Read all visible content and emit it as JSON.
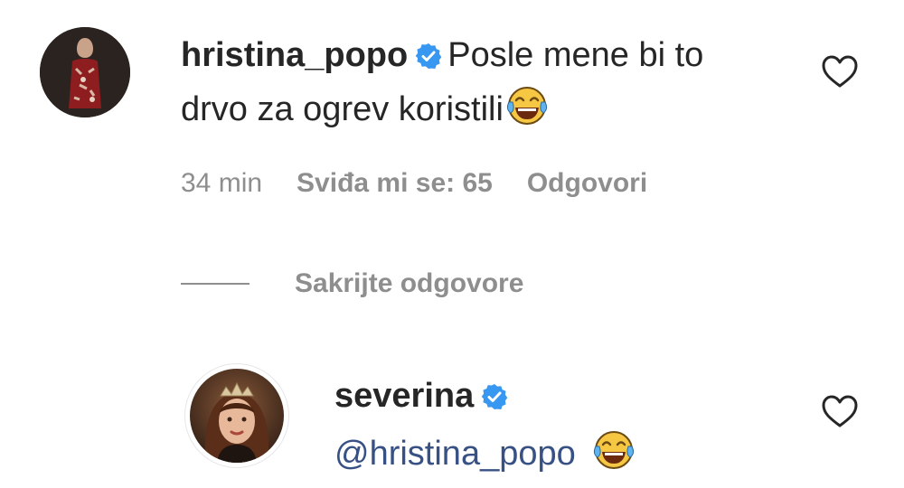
{
  "comment1": {
    "username": "hristina_popo",
    "text_line1": "Posle mene bi to",
    "text_line2": "drvo za ogrev koristili",
    "emoji": "face-with-tears-of-joy",
    "timestamp": "34 min",
    "likes_label": "Sviđa mi se: 65",
    "reply_label": "Odgovori"
  },
  "replies_toggle": {
    "label": "Sakrijte odgovore"
  },
  "comment2": {
    "username": "severina",
    "mention": "@hristina_popo",
    "emoji": "face-with-tears-of-joy"
  },
  "colors": {
    "verified": "#3897f0",
    "muted": "#8e8e8e",
    "text": "#262626",
    "mention": "#385185"
  }
}
